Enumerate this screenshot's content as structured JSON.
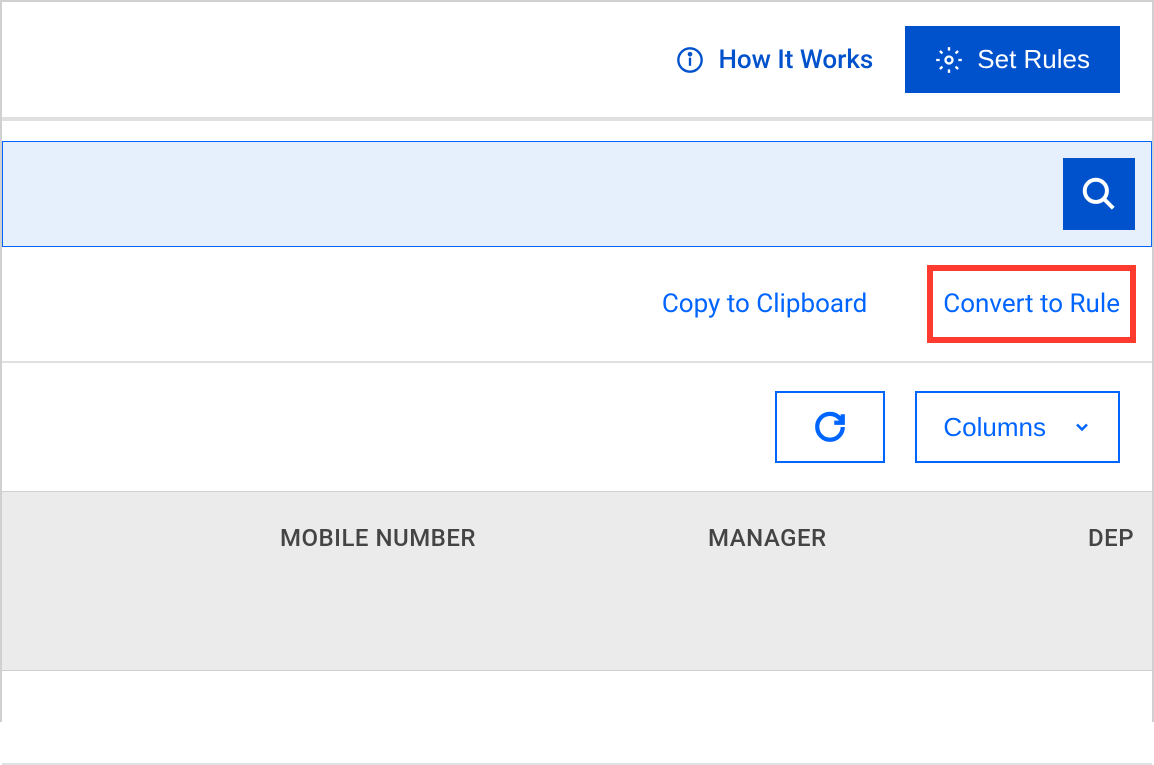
{
  "toolbar": {
    "how_it_works_label": "How It Works",
    "set_rules_label": "Set Rules"
  },
  "actions": {
    "copy_label": "Copy to Clipboard",
    "convert_label": "Convert to Rule"
  },
  "controls": {
    "columns_label": "Columns"
  },
  "table": {
    "headers": {
      "mobile": "MOBILE NUMBER",
      "manager": "MANAGER",
      "department": "DEP"
    }
  },
  "colors": {
    "primary": "#0052CC",
    "link": "#0065FF",
    "highlight_border": "#FF3B30",
    "search_bg": "#E6F0FD",
    "table_header_bg": "#EBEBEB"
  }
}
